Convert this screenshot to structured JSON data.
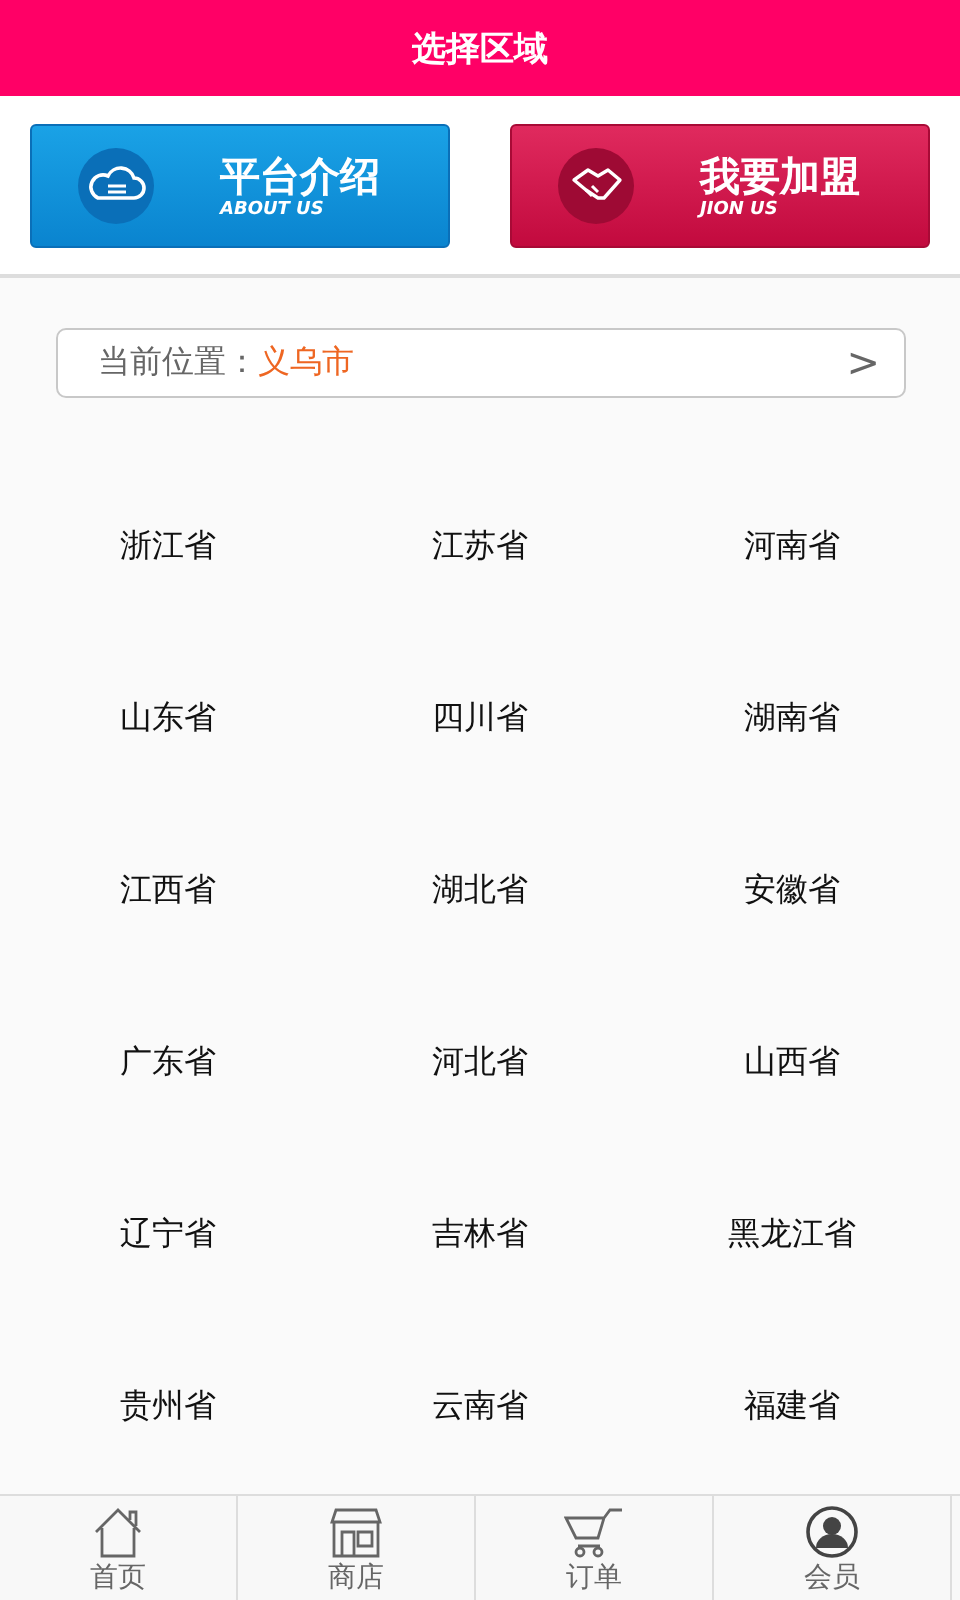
{
  "header": {
    "title": "选择区域"
  },
  "banners": [
    {
      "kind": "about",
      "title": "平台介绍",
      "subtitle": "ABOUT US"
    },
    {
      "kind": "join",
      "title": "我要加盟",
      "subtitle": "JION US"
    }
  ],
  "location": {
    "label": "当前位置：",
    "value": "义乌市",
    "chevron": ">"
  },
  "provinces": [
    "浙江省",
    "江苏省",
    "河南省",
    "山东省",
    "四川省",
    "湖南省",
    "江西省",
    "湖北省",
    "安徽省",
    "广东省",
    "河北省",
    "山西省",
    "辽宁省",
    "吉林省",
    "黑龙江省",
    "贵州省",
    "云南省",
    "福建省"
  ],
  "tabs": [
    {
      "kind": "home",
      "label": "首页"
    },
    {
      "kind": "shop",
      "label": "商店"
    },
    {
      "kind": "cart",
      "label": "订单"
    },
    {
      "kind": "user",
      "label": "会员"
    }
  ]
}
